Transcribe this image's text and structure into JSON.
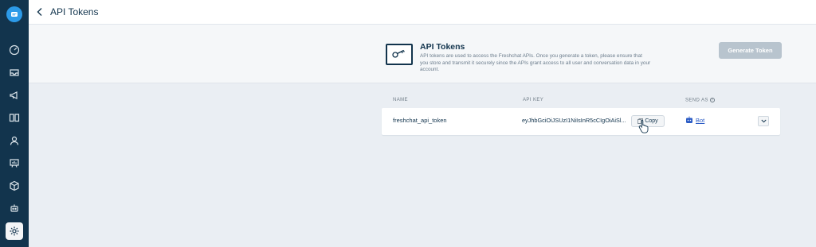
{
  "header": {
    "title": "API Tokens"
  },
  "sidebar": {
    "items": [
      {
        "icon": "dashboard-icon"
      },
      {
        "icon": "inbox-icon"
      },
      {
        "icon": "campaigns-icon"
      },
      {
        "icon": "faq-book-icon"
      },
      {
        "icon": "contacts-icon"
      },
      {
        "icon": "reports-icon"
      },
      {
        "icon": "apps-cube-icon"
      },
      {
        "icon": "bot-icon"
      },
      {
        "icon": "settings-icon",
        "active": true
      }
    ]
  },
  "hero": {
    "title": "API Tokens",
    "description": "API tokens are used to access the Freshchat APIs. Once you generate a token, please ensure that you store and transmit it securely since the APIs grant access to all user and conversation data in your account.",
    "generate_label": "Generate Token"
  },
  "table": {
    "columns": {
      "name": "NAME",
      "api_key": "API KEY",
      "send_as": "SEND AS"
    },
    "rows": [
      {
        "name": "freshchat_api_token",
        "api_key": "eyJhbGciOiJSUzI1NiIsInR5cCIgOiAiSl...",
        "copy_label": "Copy",
        "send_as": "Bot"
      }
    ]
  },
  "colors": {
    "sidebar_bg": "#12344d",
    "accent": "#2c9ae8",
    "link": "#2c5cc5",
    "button_disabled": "#b8c4ce"
  }
}
